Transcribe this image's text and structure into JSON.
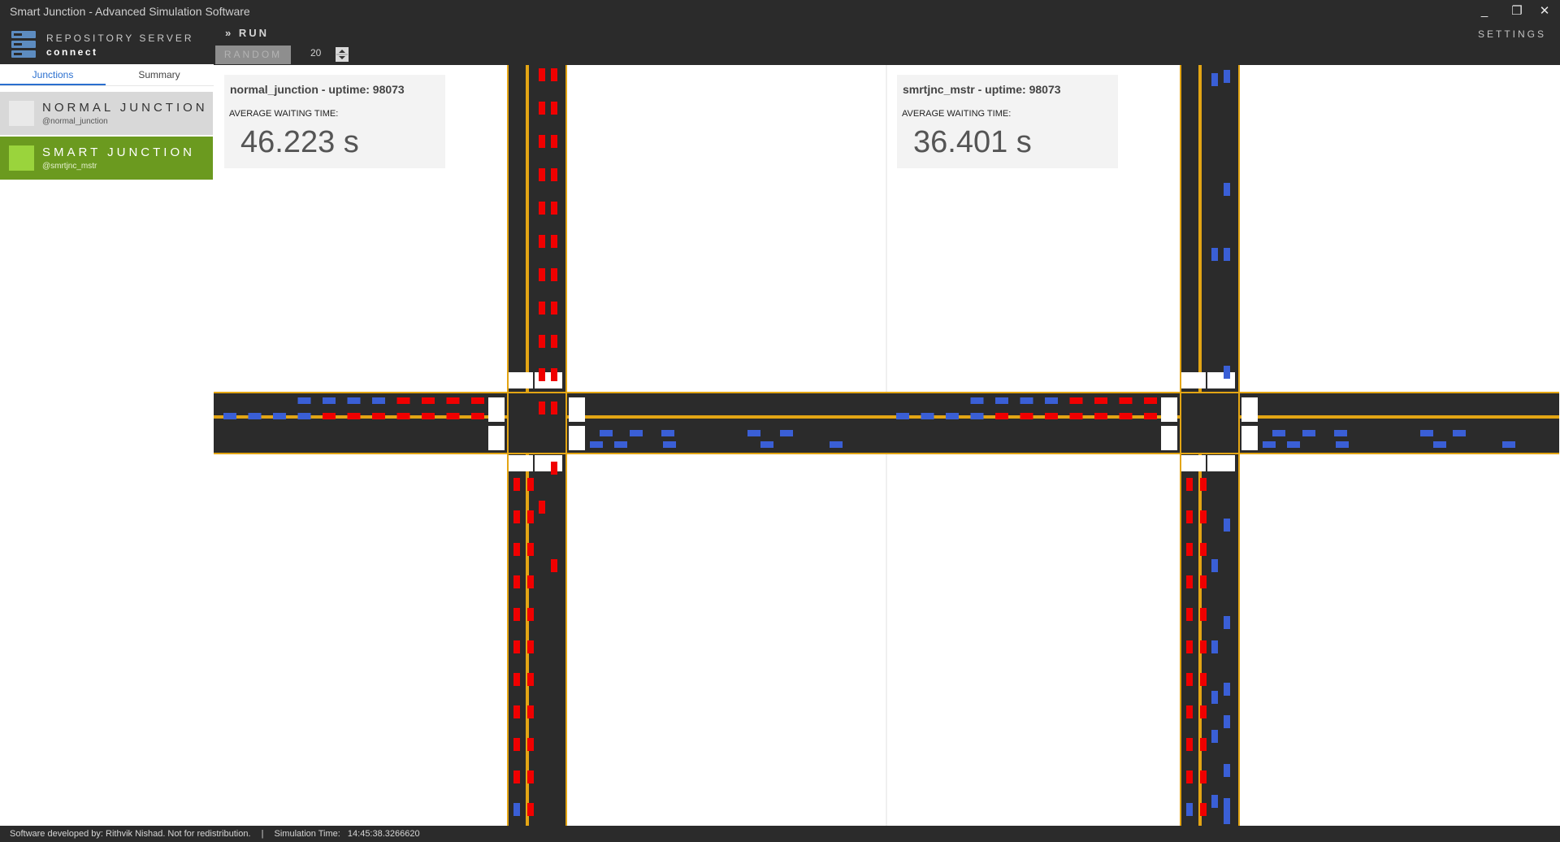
{
  "window": {
    "title": "Smart Junction - Advanced Simulation Software",
    "minimize": "_",
    "restore": "❐",
    "close": "✕"
  },
  "repository": {
    "title": "REPOSITORY SERVER",
    "action": "connect"
  },
  "tabs": [
    {
      "label": "Junctions"
    },
    {
      "label": "Summary"
    }
  ],
  "junctions": [
    {
      "name": "NORMAL JUNCTION",
      "handle": "@normal_junction",
      "color": "#d8d8d8"
    },
    {
      "name": "SMART JUNCTION",
      "handle": "@smrtjnc_mstr",
      "color": "#6b9a1f"
    }
  ],
  "toolbar": {
    "run_label": "» RUN",
    "random_label": "RANDOM",
    "count_value": "20",
    "settings_label": "SETTINGS"
  },
  "simulations": [
    {
      "header": "normal_junction - uptime: 98073",
      "label": "AVERAGE WAITING TIME:",
      "value": "46.223 s"
    },
    {
      "header": "smrtjnc_mstr - uptime: 98073",
      "label": "AVERAGE WAITING TIME:",
      "value": "36.401 s"
    }
  ],
  "status": {
    "credit": "Software developed by: Rithvik Nishad. Not for redistribution.",
    "separator": "|",
    "sim_time_label": "Simulation Time:",
    "sim_time": "14:45:38.3266620"
  },
  "colors": {
    "road": "#2b2b2b",
    "lane_line": "#e3a514",
    "car_waiting": "#f00000",
    "car_moving": "#3a5fd6",
    "crosswalk": "#ffffff"
  }
}
